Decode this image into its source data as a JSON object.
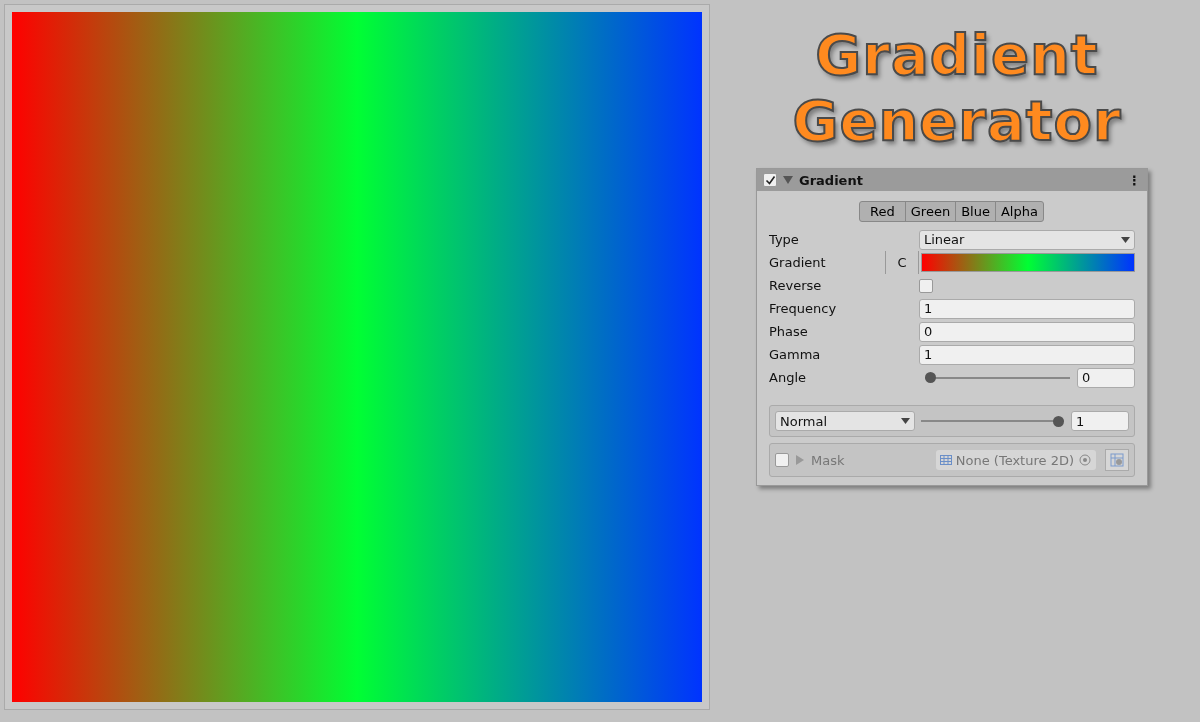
{
  "preview": {
    "stops": [
      {
        "color": "#ff0000"
      },
      {
        "color": "#00ff33"
      },
      {
        "color": "#0033ff"
      }
    ]
  },
  "title": {
    "lines": [
      "Gradient",
      "Generator"
    ]
  },
  "component": {
    "name": "Gradient",
    "enabled": true,
    "expanded": true,
    "menu": "⋮",
    "channels": [
      {
        "label": "Red"
      },
      {
        "label": "Green"
      },
      {
        "label": "Blue"
      },
      {
        "label": "Alpha"
      }
    ],
    "fields": [
      {
        "kind": "dropdown",
        "label": "Type",
        "value": "Linear"
      },
      {
        "kind": "gradient",
        "label": "Gradient",
        "button": "C"
      },
      {
        "kind": "checkbox",
        "label": "Reverse",
        "checked": false
      },
      {
        "kind": "number",
        "label": "Frequency",
        "value": "1"
      },
      {
        "kind": "number",
        "label": "Phase",
        "value": "0"
      },
      {
        "kind": "number",
        "label": "Gamma",
        "value": "1"
      },
      {
        "kind": "slider",
        "label": "Angle",
        "level": 0,
        "value": "0"
      }
    ],
    "blend": {
      "mode": "Normal",
      "level": 1,
      "value": "1"
    },
    "mask": {
      "label": "Mask",
      "enabled": false,
      "expanded": false,
      "texture": "None (Texture 2D)"
    }
  }
}
